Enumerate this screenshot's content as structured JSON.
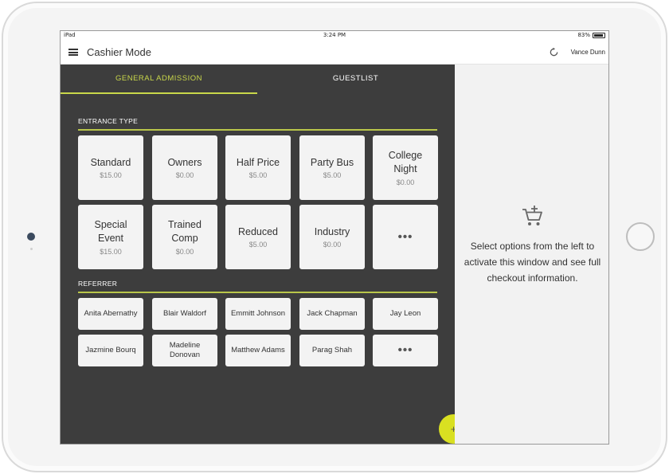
{
  "status_bar": {
    "device": "iPad",
    "time": "3:24 PM",
    "battery": "83%"
  },
  "header": {
    "title": "Cashier Mode",
    "user": "Vance Dunn"
  },
  "tabs": [
    {
      "label": "GENERAL ADMISSION",
      "active": true
    },
    {
      "label": "GUESTLIST",
      "active": false
    }
  ],
  "entrance": {
    "label": "ENTRANCE TYPE",
    "types": [
      {
        "name": "Standard",
        "price": "$15.00"
      },
      {
        "name": "Owners",
        "price": "$0.00"
      },
      {
        "name": "Half Price",
        "price": "$5.00"
      },
      {
        "name": "Party Bus",
        "price": "$5.00"
      },
      {
        "name": "College Night",
        "price": "$0.00"
      },
      {
        "name": "Special Event",
        "price": "$15.00"
      },
      {
        "name": "Trained Comp",
        "price": "$0.00"
      },
      {
        "name": "Reduced",
        "price": "$5.00"
      },
      {
        "name": "Industry",
        "price": "$0.00"
      }
    ],
    "more": "•••"
  },
  "referrer": {
    "label": "REFERRER",
    "people": [
      "Anita Abernathy",
      "Blair Waldorf",
      "Emmitt Johnson",
      "Jack Chapman",
      "Jay Leon",
      "Jazmine Bourq",
      "Madeline Donovan",
      "Matthew Adams",
      "Parag Shah"
    ],
    "more": "•••"
  },
  "fab": {
    "label": "+"
  },
  "checkout": {
    "message": "Select options from the left to activate this window and see full checkout information."
  },
  "colors": {
    "accent": "#c9d74a",
    "fab": "#d9e021",
    "panel_dark": "#3d3d3d",
    "panel_light": "#f2f2f2"
  },
  "icons": [
    "menu-icon",
    "sync-icon",
    "add-to-cart-icon",
    "battery-icon",
    "wifi-icon"
  ]
}
